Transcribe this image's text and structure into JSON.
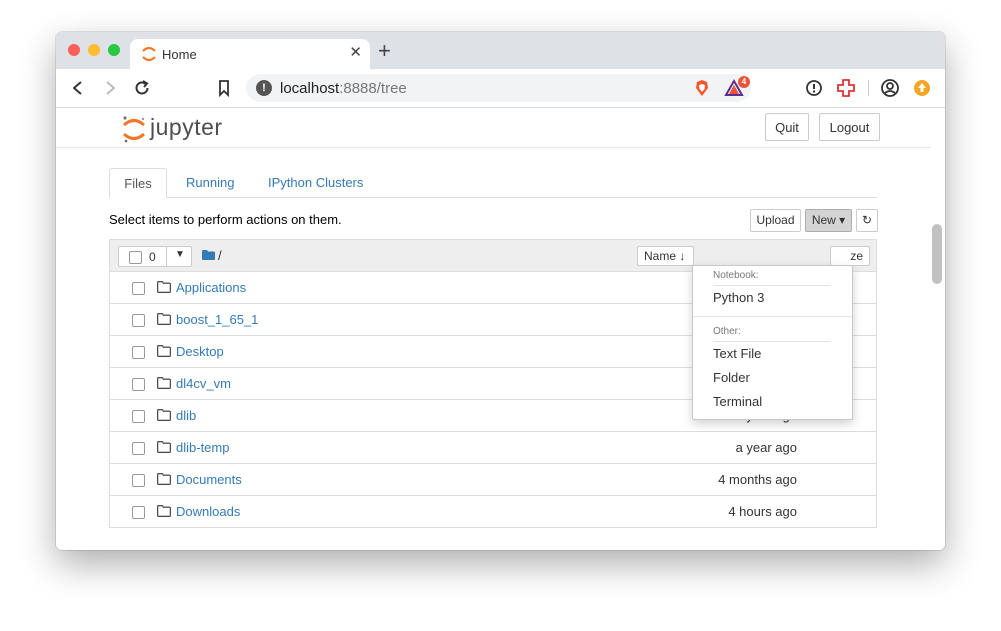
{
  "browser": {
    "tab_title": "Home",
    "tab_close": "✕",
    "new_tab": "+",
    "url_host": "localhost",
    "url_rest": ":8888/tree",
    "ext_badge_count": "4"
  },
  "header": {
    "wordmark": "jupyter",
    "quit_label": "Quit",
    "logout_label": "Logout"
  },
  "tabs": {
    "files": "Files",
    "running": "Running",
    "clusters": "IPython Clusters"
  },
  "toolbar": {
    "instructions": "Select items to perform actions on them.",
    "upload_label": "Upload",
    "new_label": "New ▾",
    "refresh_icon": "↻"
  },
  "listing": {
    "selected_count": "0",
    "breadcrumb": "/",
    "name_sort": "Name ↓",
    "size_sort": "ze",
    "rows": [
      {
        "name": "Applications",
        "date": ""
      },
      {
        "name": "boost_1_65_1",
        "date": ""
      },
      {
        "name": "Desktop",
        "date": ""
      },
      {
        "name": "dl4cv_vm",
        "date": "2 years ago"
      },
      {
        "name": "dlib",
        "date": "a year ago"
      },
      {
        "name": "dlib-temp",
        "date": "a year ago"
      },
      {
        "name": "Documents",
        "date": "4 months ago"
      },
      {
        "name": "Downloads",
        "date": "4 hours ago"
      }
    ]
  },
  "new_menu": {
    "notebook_header": "Notebook:",
    "python3": "Python 3",
    "other_header": "Other:",
    "text_file": "Text File",
    "folder": "Folder",
    "terminal": "Terminal"
  },
  "colors": {
    "link": "#337ab7",
    "jupyter_orange": "#f37726"
  }
}
